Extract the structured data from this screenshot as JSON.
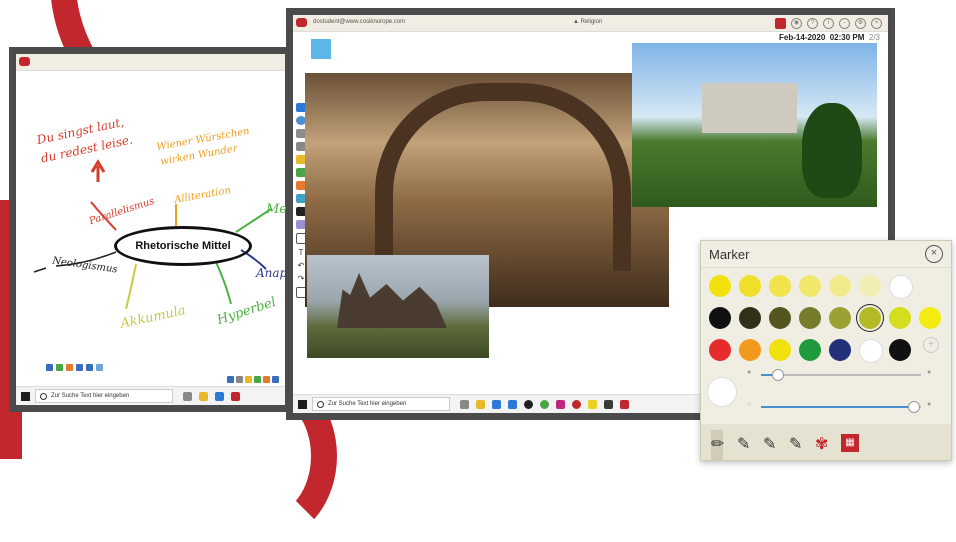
{
  "right_window": {
    "user_email": "dostudent@www.coskinurope.com",
    "app_name": "Religion",
    "date": "Feb-14-2020",
    "time": "02:30 PM",
    "page": "2/3",
    "taskbar_search": "Zur Suche Text hier eingeben"
  },
  "left_window": {
    "taskbar_search": "Zur Suche Text hier eingeben",
    "mindmap": {
      "center": "Rhetorische Mittel",
      "nodes": [
        {
          "text": "Du singst laut,",
          "color": "#d93a2a"
        },
        {
          "text": "du redest leise.",
          "color": "#d93a2a"
        },
        {
          "text": "Parallelismus",
          "color": "#d93a2a"
        },
        {
          "text": "Wiener Würstchen",
          "color": "#f0a020"
        },
        {
          "text": "wirken Wunder",
          "color": "#f0a020"
        },
        {
          "text": "Alliteration",
          "color": "#f0a020"
        },
        {
          "text": "Neologismus",
          "color": "#222222"
        },
        {
          "text": "Akkumula",
          "color": "#c8cc40"
        },
        {
          "text": "Hyperbel",
          "color": "#4ab33f"
        },
        {
          "text": "Met",
          "color": "#4ab33f"
        },
        {
          "text": "Anaph",
          "color": "#2f3a8f"
        }
      ]
    }
  },
  "marker_panel": {
    "title": "Marker",
    "swatch_rows": [
      [
        "#f2e10c",
        "#f1e02b",
        "#f1e44a",
        "#f1e76a",
        "#f1ea8c",
        "#f0eeb5",
        "#ffffff"
      ],
      [
        "#111111",
        "#2f3218",
        "#55561f",
        "#777b2c",
        "#9aa132",
        "#b3ba28",
        "#d4de1e",
        "#f4eb13"
      ],
      [
        "#e52b2b",
        "#f29a1c",
        "#f2e10c",
        "#1f9a3a",
        "#23307a",
        "#ffffff",
        "#111111"
      ]
    ],
    "selected_swatch": "#b3ba28",
    "size_slider": 0.1,
    "opacity_slider": 0.95
  }
}
